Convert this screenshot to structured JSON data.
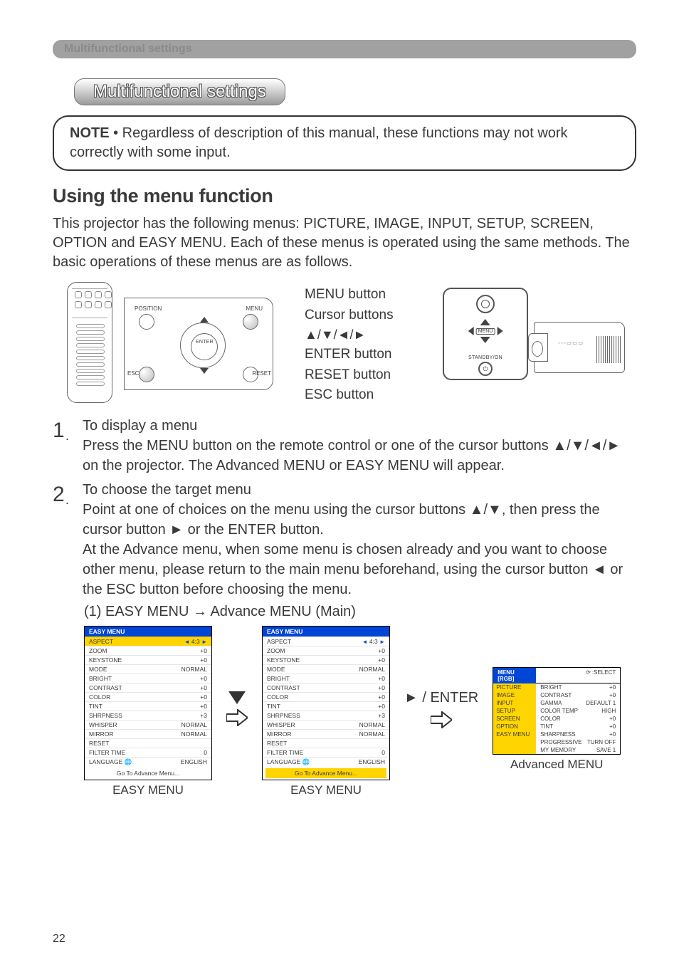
{
  "breadcrumb": "Multifunctional settings",
  "title": "Multifunctional settings",
  "note": {
    "label": "NOTE",
    "text": "  • Regardless of description of this manual, these functions may not work correctly with some input."
  },
  "section_heading": "Using the menu function",
  "intro": "This projector has the following menus: PICTURE, IMAGE, INPUT, SETUP, SCREEN, OPTION and EASY MENU. Each of these menus is operated using the same methods. The basic operations of these menus are as follows.",
  "remote": {
    "position": "POSITION",
    "menu": "MENU",
    "enter": "ENTER",
    "esc": "ESC",
    "reset": "RESET"
  },
  "callouts": {
    "menu_btn": "MENU button",
    "cursor": "Cursor buttons",
    "arrows": "▲/▼/◄/►",
    "enter": "ENTER button",
    "reset": "RESET button",
    "esc": "ESC button"
  },
  "projector": {
    "menu": "MENU",
    "standby": "STANDBY/ON",
    "power": "⏻",
    "panel": "◦ ◦ ◦ ▭ ▭ ▭"
  },
  "steps": {
    "s1_title": "To display a menu",
    "s1_body": "Press the MENU button on the remote control or one of the cursor buttons ▲/▼/◄/► on the projector. The Advanced MENU or EASY MENU will appear.",
    "s2_title": "To choose the target menu",
    "s2_body": "Point at one of choices on the menu using the cursor buttons ▲/▼, then press the cursor button ► or the ENTER button.",
    "s2_body2": "At the Advance menu, when some menu is chosen already and you want to choose other menu, please return to the main menu beforehand, using the cursor button ◄ or the ESC button before choosing the menu.",
    "sub1": "(1) EASY MENU → Advance MENU (Main)"
  },
  "easy_menu": {
    "header": "EASY MENU",
    "rows": [
      {
        "k": "ASPECT",
        "v": "4:3",
        "lr": true
      },
      {
        "k": "ZOOM",
        "v": "+0"
      },
      {
        "k": "KEYSTONE",
        "v": "+0"
      },
      {
        "k": "MODE",
        "v": "NORMAL"
      },
      {
        "k": "BRIGHT",
        "v": "+0"
      },
      {
        "k": "CONTRAST",
        "v": "+0"
      },
      {
        "k": "COLOR",
        "v": "+0"
      },
      {
        "k": "TINT",
        "v": "+0"
      },
      {
        "k": "SHRPNESS",
        "v": "+3"
      },
      {
        "k": "WHISPER",
        "v": "NORMAL"
      },
      {
        "k": "MIRROR",
        "v": "NORMAL"
      },
      {
        "k": "RESET",
        "v": ""
      },
      {
        "k": "FILTER TIME",
        "v": "0"
      },
      {
        "k": "LANGUAGE    🌐",
        "v": "ENGLISH"
      }
    ],
    "footer": "Go To Advance Menu...",
    "caption": "EASY MENU"
  },
  "flow": {
    "down": "▼",
    "right_enter": "► / ENTER"
  },
  "adv_menu": {
    "header_l": "MENU [RGB]",
    "header_r": "⟳ :SELECT",
    "side": [
      "PICTURE",
      "IMAGE",
      "INPUT",
      "SETUP",
      "SCREEN",
      "OPTION",
      "EASY MENU"
    ],
    "rows": [
      {
        "k": "BRIGHT",
        "v": "+0"
      },
      {
        "k": "CONTRAST",
        "v": "+0"
      },
      {
        "k": "GAMMA",
        "v": "DEFAULT 1"
      },
      {
        "k": "COLOR TEMP",
        "v": "HIGH"
      },
      {
        "k": "COLOR",
        "v": "+0"
      },
      {
        "k": "TINT",
        "v": "+0"
      },
      {
        "k": "SHARPNESS",
        "v": "+0"
      },
      {
        "k": "PROGRESSIVE",
        "v": "TURN OFF"
      },
      {
        "k": "MY MEMORY",
        "v": "SAVE 1"
      }
    ],
    "caption": "Advanced MENU"
  },
  "page_number": "22"
}
